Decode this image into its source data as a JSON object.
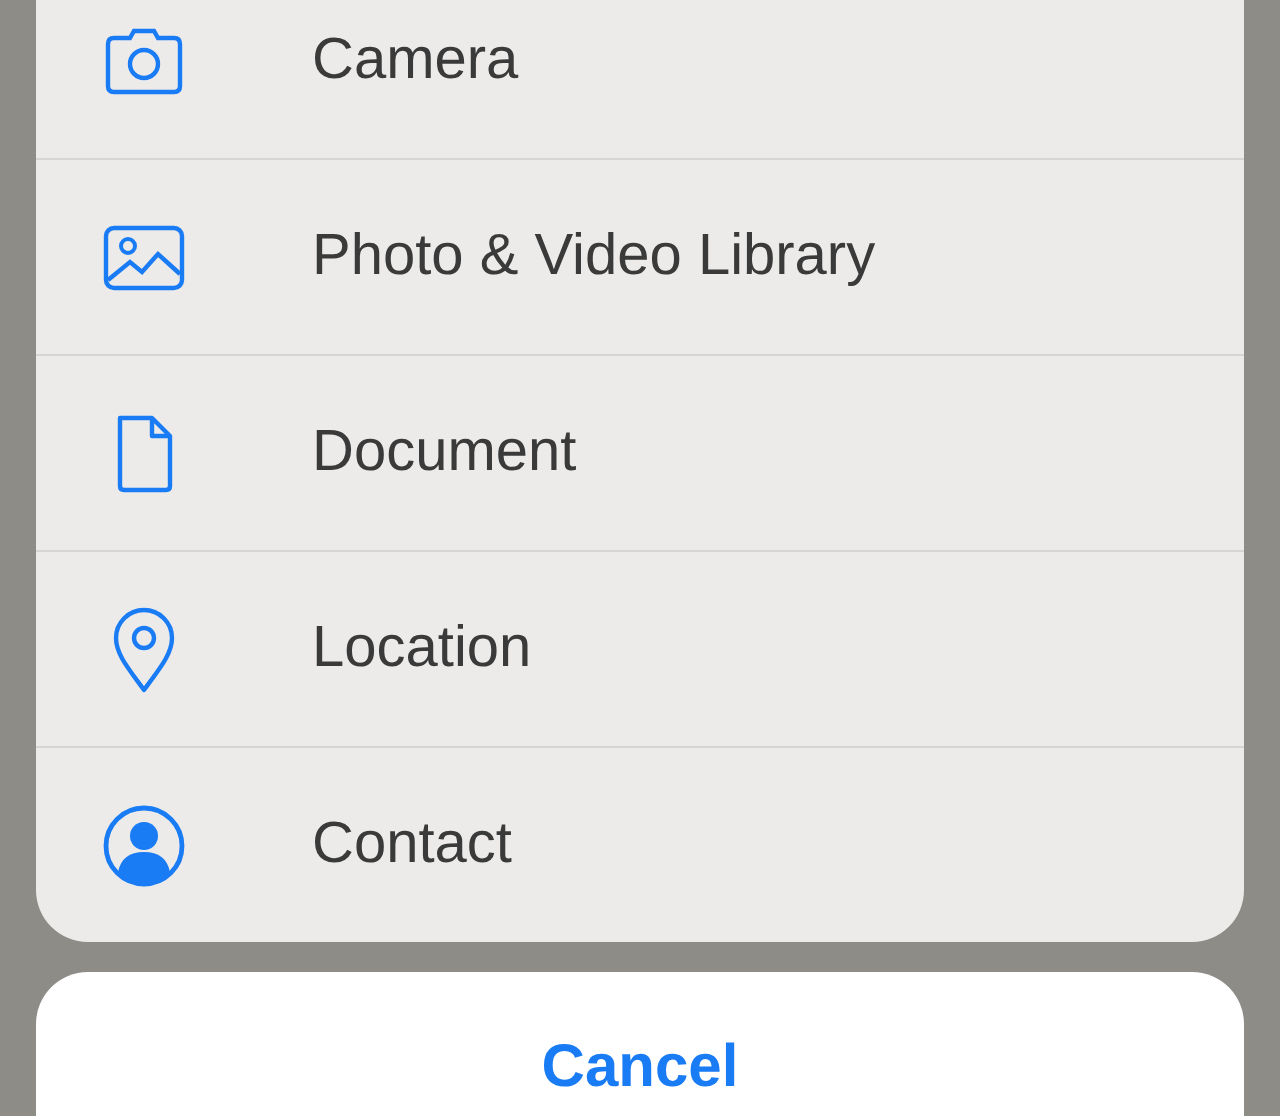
{
  "action_sheet": {
    "items": [
      {
        "kind": "camera",
        "label": "Camera"
      },
      {
        "kind": "photo",
        "label": "Photo & Video Library"
      },
      {
        "kind": "document",
        "label": "Document"
      },
      {
        "kind": "location",
        "label": "Location"
      },
      {
        "kind": "contact",
        "label": "Contact"
      }
    ],
    "cancel": "Cancel"
  }
}
